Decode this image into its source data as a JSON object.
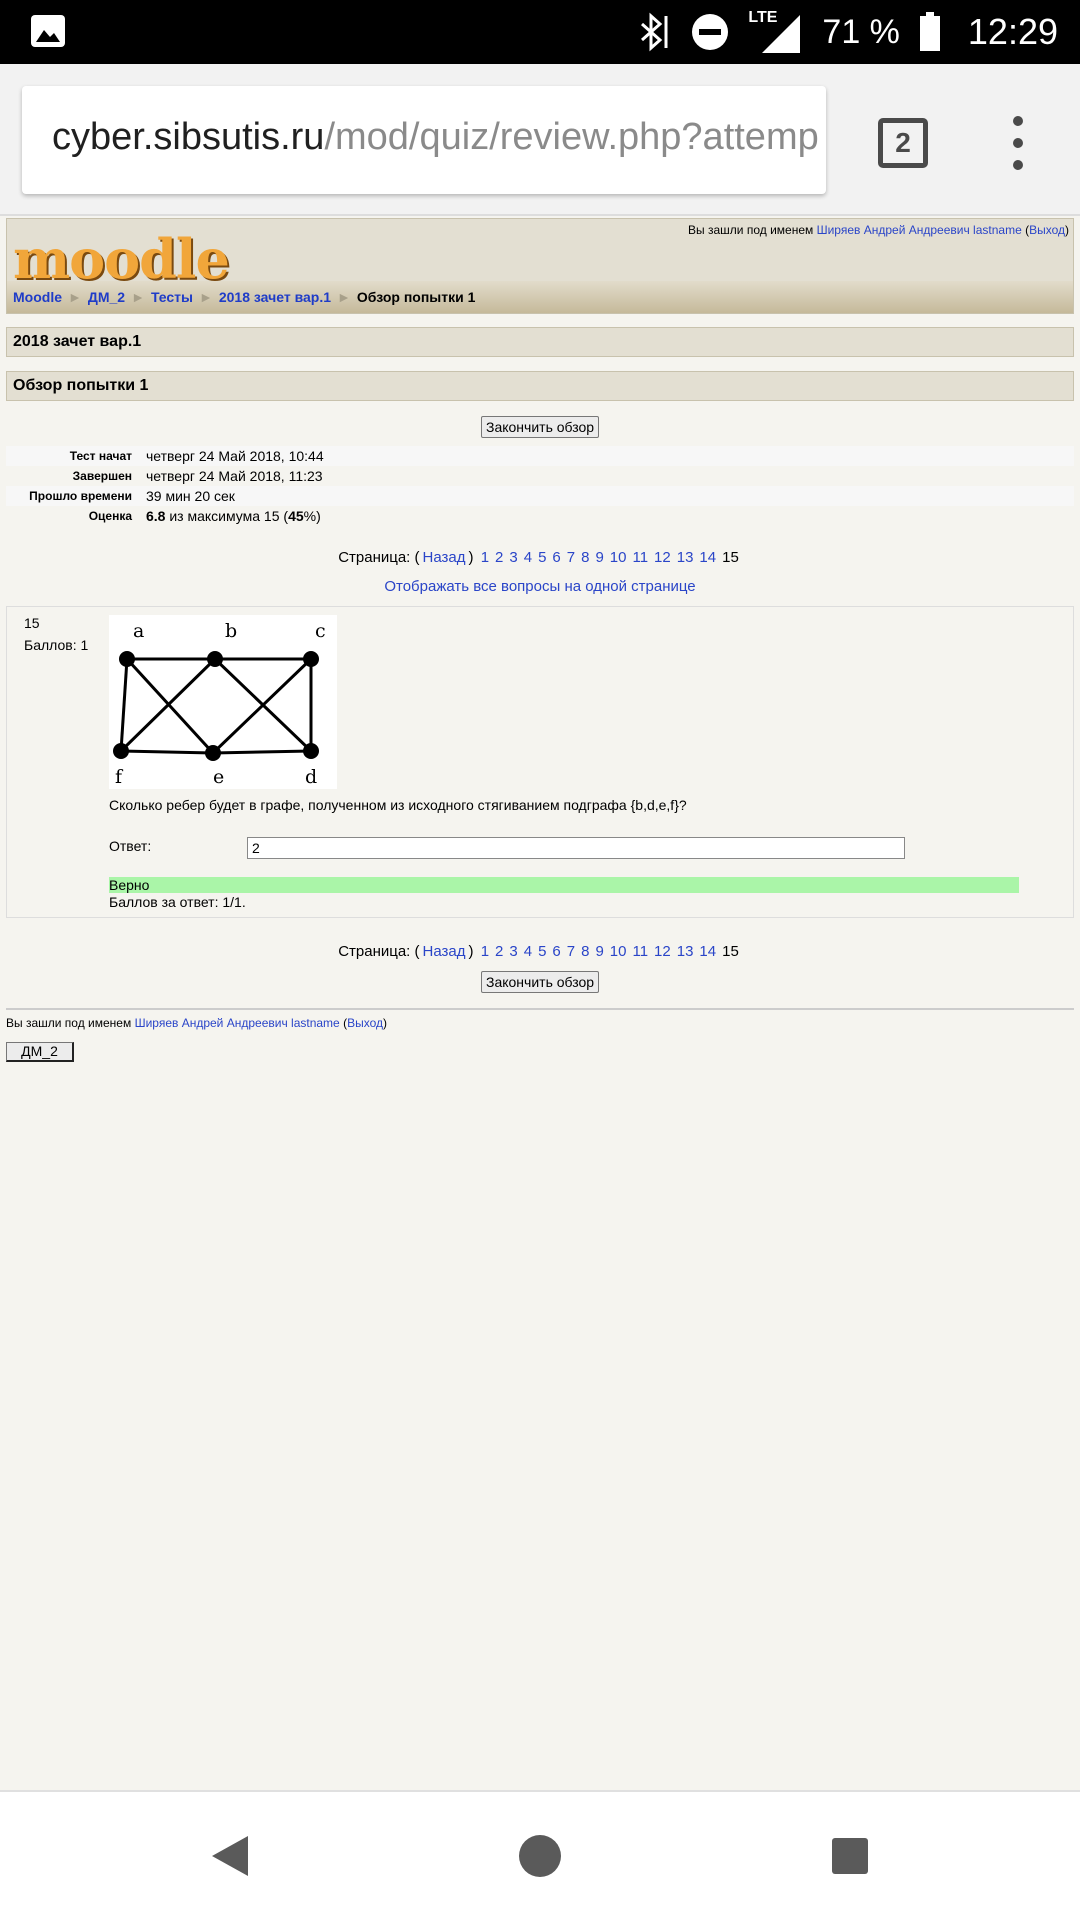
{
  "status_bar": {
    "lte": "LTE",
    "battery": "71 %",
    "time": "12:29"
  },
  "browser": {
    "url_host": "cyber.sibsutis.ru",
    "url_path": "/mod/quiz/review.php?attemp",
    "tab_count": "2"
  },
  "header": {
    "logo": "moodle",
    "login_prefix": "Вы зашли под именем",
    "user": "Ширяев Андрей Андреевич lastname",
    "logout": "Выход"
  },
  "breadcrumb": [
    "Moodle",
    "ДМ_2",
    "Тесты",
    "2018 зачет вар.1"
  ],
  "breadcrumb_current": "Обзор попытки 1",
  "quiz_title": "2018 зачет вар.1",
  "review_title": "Обзор попытки 1",
  "finish_label": "Закончить обзор",
  "summary": [
    {
      "label": "Тест начат",
      "value": "четверг 24 Май 2018, 10:44"
    },
    {
      "label": "Завершен",
      "value": "четверг 24 Май 2018, 11:23"
    },
    {
      "label": "Прошло времени",
      "value": "39 мин 20 сек"
    },
    {
      "label": "Оценка",
      "score": "6.8",
      "mid": "из максимума 15 (",
      "percent": "45",
      "end": "%)"
    }
  ],
  "pager": {
    "label": "Страница:",
    "prev": "Назад",
    "pages": [
      "1",
      "2",
      "3",
      "4",
      "5",
      "6",
      "7",
      "8",
      "9",
      "10",
      "11",
      "12",
      "13",
      "14"
    ],
    "current": "15"
  },
  "show_all": "Отображать все вопросы на одной странице",
  "question": {
    "number": "15",
    "marks": "Баллов: 1",
    "graph_labels": [
      "a",
      "b",
      "c",
      "f",
      "e",
      "d"
    ],
    "text": "Сколько ребер будет в графе, полученном из исходного стягиванием подграфа {b,d,e,f}?",
    "answer_label": "Ответ:",
    "answer_value": "2",
    "feedback": "Верно",
    "score": "Баллов за ответ: 1/1."
  },
  "footer": {
    "login_prefix": "Вы зашли под именем",
    "user": "Ширяев Андрей Андреевич lastname",
    "logout": "Выход",
    "course_button": "ДМ_2"
  }
}
